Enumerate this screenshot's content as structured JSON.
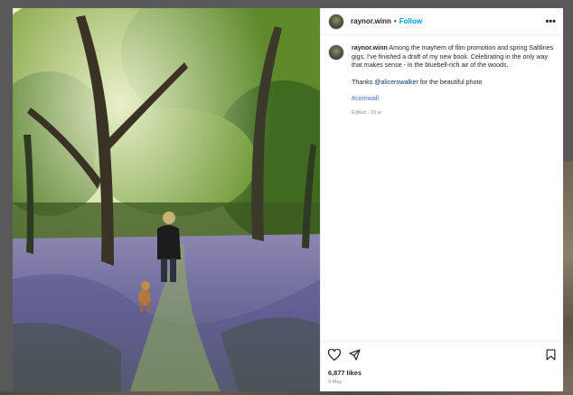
{
  "post": {
    "username": "raynor.winn",
    "header_separator": "•",
    "follow_label": "Follow",
    "more_icon": "more-horizontal-icon",
    "caption": {
      "username": "raynor.winn",
      "text": " Among the mayhem of film promotion and spring Saltlines gigs, I've finished a draft of my new book. Celebrating in the only way that makes sense - in the bluebell-rich air of the woods.",
      "thanks_prefix": "Thanks ",
      "mention": "@alicerowalker",
      "thanks_suffix": " for the beautiful photo",
      "hashtag": "#cornwall",
      "edited": "Edited · 10 w"
    },
    "actions": {
      "like_icon": "heart-icon",
      "share_icon": "send-icon",
      "save_icon": "bookmark-icon"
    },
    "likes": "6,877 likes",
    "date": "9 May"
  },
  "colors": {
    "link_blue": "#0095f6",
    "hashtag_blue": "#4a6cc6",
    "muted_gray": "#8e8e8e"
  }
}
